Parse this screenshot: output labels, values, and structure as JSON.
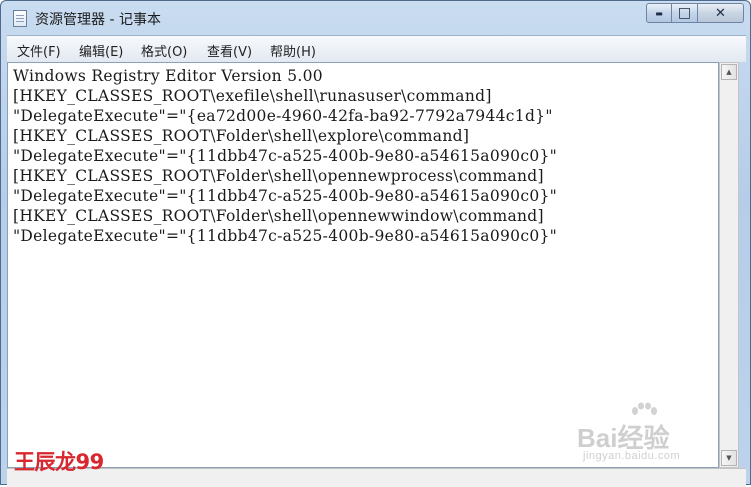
{
  "window": {
    "title": "资源管理器 - 记事本",
    "minimize_glyph": "▬",
    "maximize_glyph": "□",
    "close_glyph": "✕"
  },
  "menubar": {
    "items": [
      "文件(F)",
      "编辑(E)",
      "格式(O)",
      "查看(V)",
      "帮助(H)"
    ]
  },
  "editor": {
    "lines": [
      "Windows Registry Editor Version 5.00",
      "[HKEY_CLASSES_ROOT\\exefile\\shell\\runasuser\\command]",
      "\"DelegateExecute\"=\"{ea72d00e-4960-42fa-ba92-7792a7944c1d}\"",
      "[HKEY_CLASSES_ROOT\\Folder\\shell\\explore\\command]",
      "\"DelegateExecute\"=\"{11dbb47c-a525-400b-9e80-a54615a090c0}\"",
      "[HKEY_CLASSES_ROOT\\Folder\\shell\\opennewprocess\\command]",
      "\"DelegateExecute\"=\"{11dbb47c-a525-400b-9e80-a54615a090c0}\"",
      "[HKEY_CLASSES_ROOT\\Folder\\shell\\opennewwindow\\command]",
      "\"DelegateExecute\"=\"{11dbb47c-a525-400b-9e80-a54615a090c0}\""
    ]
  },
  "scrollbar": {
    "up_glyph": "▲",
    "down_glyph": "▼"
  },
  "watermarks": {
    "author": "王辰龙99",
    "baidu_logo": "Bai经验",
    "baidu_url": "jingyan.baidu.com"
  },
  "colors": {
    "author_watermark": "#d8272e",
    "titlebar": "#c9dcf0",
    "editor_bg": "#ffffff"
  }
}
